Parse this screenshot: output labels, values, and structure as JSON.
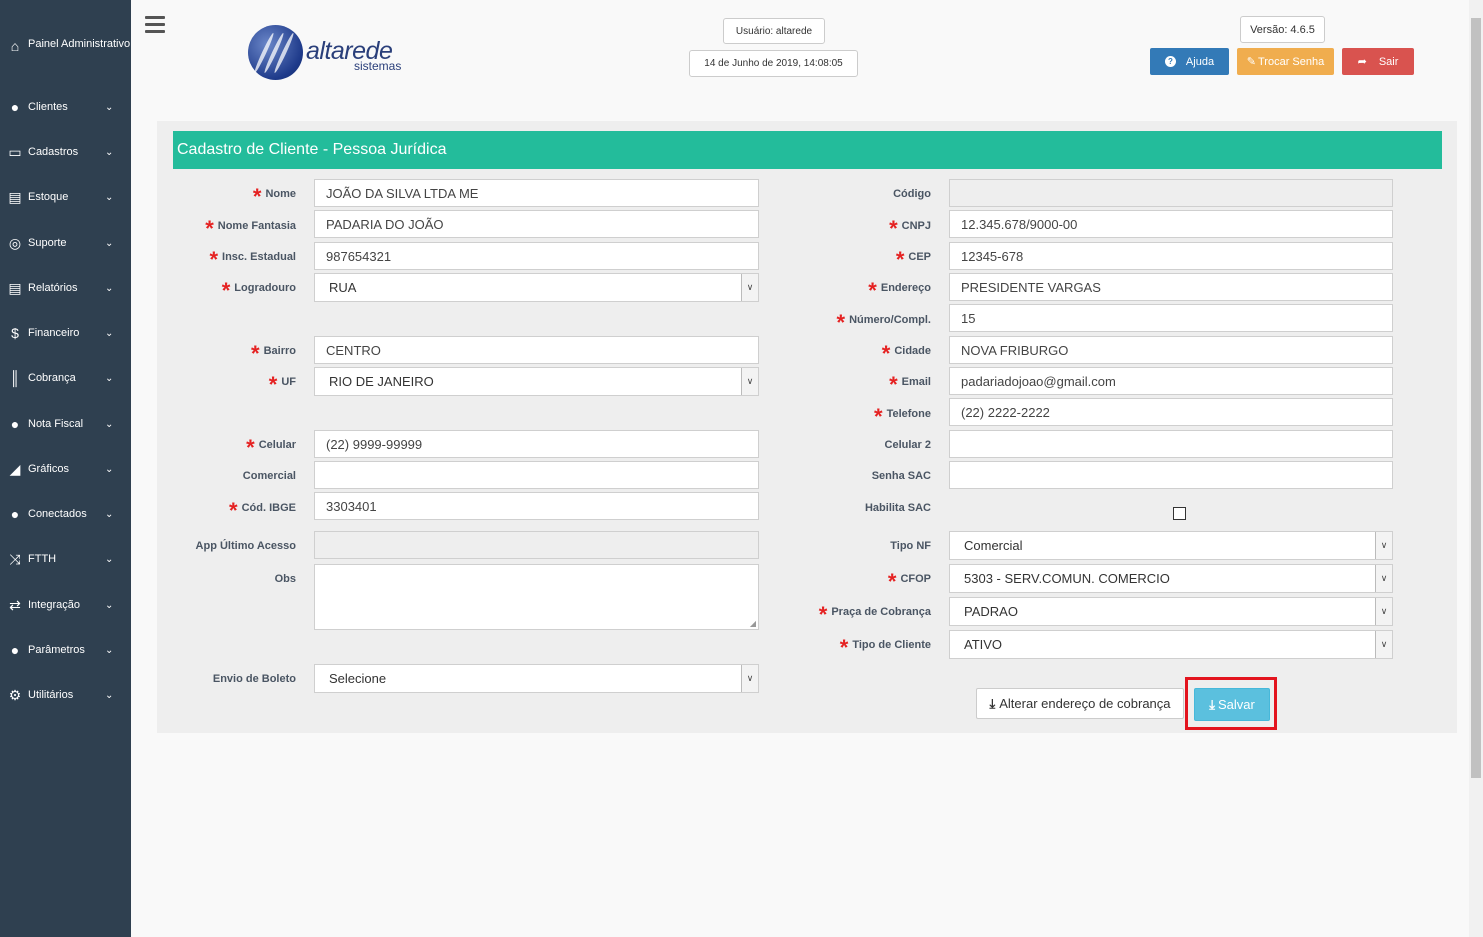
{
  "sidebar": {
    "items": [
      {
        "label": "Painel Administrativo",
        "icon": "home-icon"
      },
      {
        "label": "Clientes",
        "icon": "user-icon"
      },
      {
        "label": "Cadastros",
        "icon": "folder-icon"
      },
      {
        "label": "Estoque",
        "icon": "printer-icon"
      },
      {
        "label": "Suporte",
        "icon": "lifebuoy-icon"
      },
      {
        "label": "Relatórios",
        "icon": "printer-icon"
      },
      {
        "label": "Financeiro",
        "icon": "dollar-icon"
      },
      {
        "label": "Cobrança",
        "icon": "barcode-icon"
      },
      {
        "label": "Nota Fiscal",
        "icon": "user-icon"
      },
      {
        "label": "Gráficos",
        "icon": "area-chart-icon"
      },
      {
        "label": "Conectados",
        "icon": "users-icon"
      },
      {
        "label": "FTTH",
        "icon": "random-icon"
      },
      {
        "label": "Integração",
        "icon": "retweet-icon"
      },
      {
        "label": "Parâmetros",
        "icon": "user-icon"
      },
      {
        "label": "Utilitários",
        "icon": "cogs-icon"
      }
    ]
  },
  "header": {
    "logo_brand": "altarede",
    "logo_sub": "sistemas",
    "user": "Usuário: altarede",
    "datetime": "14 de Junho de 2019, 14:08:05",
    "version": "Versão: 4.6.5",
    "help": "Ajuda",
    "change_password": "Trocar Senha",
    "logout": "Sair"
  },
  "form": {
    "title": "Cadastro de Cliente - Pessoa Jurídica",
    "left": {
      "nome": {
        "label": "Nome",
        "value": "JOÃO DA SILVA LTDA ME"
      },
      "nome_fantasia": {
        "label": "Nome Fantasia",
        "value": "PADARIA DO JOÃO"
      },
      "insc_estadual": {
        "label": "Insc. Estadual",
        "value": "987654321"
      },
      "logradouro": {
        "label": "Logradouro",
        "value": "RUA"
      },
      "bairro": {
        "label": "Bairro",
        "value": "CENTRO"
      },
      "uf": {
        "label": "UF",
        "value": "RIO DE JANEIRO"
      },
      "celular": {
        "label": "Celular",
        "value": "(22) 9999-99999"
      },
      "comercial": {
        "label": "Comercial",
        "value": ""
      },
      "cod_ibge": {
        "label": "Cód. IBGE",
        "value": "3303401"
      },
      "app_ultimo_acesso": {
        "label": "App Último Acesso",
        "value": ""
      },
      "obs": {
        "label": "Obs",
        "value": ""
      },
      "envio_boleto": {
        "label": "Envio de Boleto",
        "value": "Selecione"
      }
    },
    "right": {
      "codigo": {
        "label": "Código",
        "value": ""
      },
      "cnpj": {
        "label": "CNPJ",
        "value": "12.345.678/9000-00"
      },
      "cep": {
        "label": "CEP",
        "value": "12345-678"
      },
      "endereco": {
        "label": "Endereço",
        "value": "PRESIDENTE VARGAS"
      },
      "numero": {
        "label": "Número/Compl.",
        "value": "15"
      },
      "cidade": {
        "label": "Cidade",
        "value": "NOVA FRIBURGO"
      },
      "email": {
        "label": "Email",
        "value": "padariadojoao@gmail.com"
      },
      "telefone": {
        "label": "Telefone",
        "value": "(22) 2222-2222"
      },
      "celular2": {
        "label": "Celular 2",
        "value": ""
      },
      "senha_sac": {
        "label": "Senha SAC",
        "value": ""
      },
      "habilita_sac": {
        "label": "Habilita SAC",
        "checked": false
      },
      "tipo_nf": {
        "label": "Tipo NF",
        "value": "Comercial"
      },
      "cfop": {
        "label": "CFOP",
        "value": "5303 - SERV.COMUN. COMERCIO"
      },
      "praca_cobranca": {
        "label": "Praça de Cobrança",
        "value": "PADRAO"
      },
      "tipo_cliente": {
        "label": "Tipo de Cliente",
        "value": "ATIVO"
      }
    },
    "buttons": {
      "alterar": "Alterar endereço de cobrança",
      "salvar": "Salvar"
    }
  },
  "colors": {
    "sidebar": "#2f4050",
    "title_bar": "#23bc9b",
    "required": "#e52222",
    "help_btn": "#337ab7",
    "warn_btn": "#f0ad4e",
    "danger_btn": "#d9534f",
    "save_btn": "#5bc0de",
    "highlight": "#e3141e"
  }
}
